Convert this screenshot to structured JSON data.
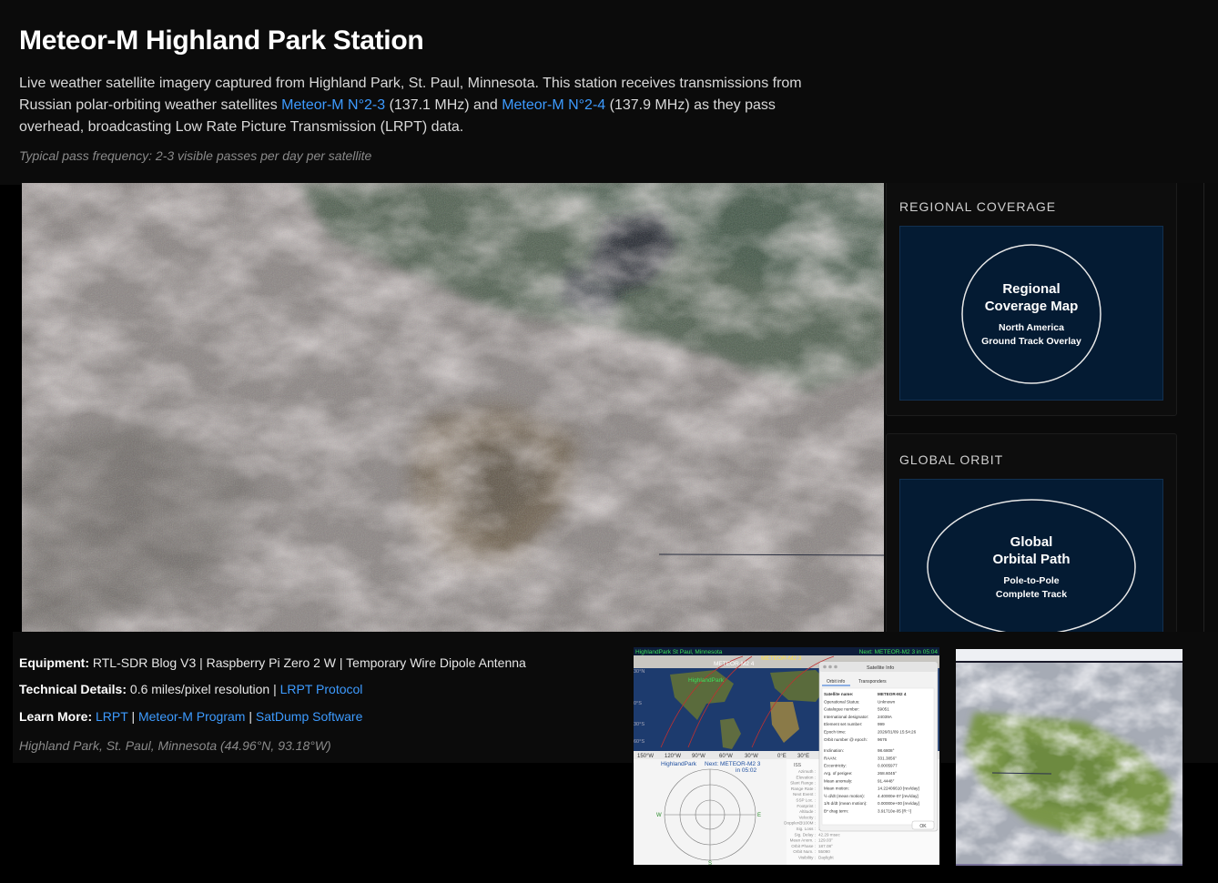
{
  "header": {
    "title": "Meteor-M Highland Park Station",
    "intro_part1": "Live weather satellite imagery captured from Highland Park, St. Paul, Minnesota. This station receives transmissions from Russian polar-orbiting weather satellites ",
    "link_m23": "Meteor-M N°2-3",
    "intro_part2": " (137.1 MHz) and ",
    "link_m24": "Meteor-M N°2-4",
    "intro_part3": " (137.9 MHz) as they pass overhead, broadcasting Low Rate Picture Transmission (LRPT) data.",
    "frequency_note": "Typical pass frequency: 2-3 visible passes per day per satellite"
  },
  "sidebar": {
    "regional": {
      "heading": "REGIONAL COVERAGE",
      "line1": "Regional",
      "line2": "Coverage Map",
      "line3": "North America",
      "line4": "Ground Track Overlay"
    },
    "global": {
      "heading": "GLOBAL ORBIT",
      "line1": "Global",
      "line2": "Orbital Path",
      "line3": "Pole-to-Pole",
      "line4": "Complete Track"
    }
  },
  "footer": {
    "equipment_label": "Equipment:",
    "equipment_value": " RTL-SDR Blog V3 | Raspberry Pi Zero 2 W | Temporary Wire Dipole Antenna",
    "tech_label": "Technical Details:",
    "tech_value": " 0.6 miles/pixel resolution | ",
    "tech_link": "LRPT Protocol",
    "learn_label": "Learn More:",
    "learn_link1": "LRPT",
    "sep": " | ",
    "learn_link2": "Meteor-M Program",
    "learn_link3": "SatDump Software",
    "location": "Highland Park, St. Paul, Minnesota (44.96°N, 93.18°W)"
  },
  "gpredict": {
    "map_location": "HighlandPark  St Paul, Minnesota",
    "map_next": "Next: METEOR-M2 3 in 05:04",
    "sat_label_1": "METEOR-M2 3",
    "sat_label_2": "METEOR-M2 4",
    "station_label": "HighlandPark",
    "lon_labels": [
      "150°W",
      "120°W",
      "90°W",
      "60°W",
      "30°W",
      "0°E",
      "30°E"
    ],
    "lat_labels": [
      "30°N",
      "0°S",
      "30°S",
      "60°S"
    ],
    "polar_title": "HighlandPark",
    "polar_next": "Next: METEOR-M2 3",
    "polar_in": "in 05:02",
    "polar_w": "W",
    "polar_e": "E",
    "polar_s": "S",
    "dialog_title": "Satellite Info",
    "dialog_tab1": "Orbit info",
    "dialog_tab2": "Transponders",
    "dialog_rows": [
      [
        "Satellite name:",
        "METEOR-M2 4"
      ],
      [
        "Operational Status:",
        "Unknown"
      ],
      [
        "Catalogue number:",
        "59051"
      ],
      [
        "International designator:",
        "24039A"
      ],
      [
        "Element set number:",
        "999"
      ],
      [
        "Epoch time:",
        "2026/01/09 15:54:26"
      ],
      [
        "Orbit number @ epoch:",
        "9676"
      ],
      [
        "Inclination:",
        "98.6808°"
      ],
      [
        "RAAN:",
        "331.3856°"
      ],
      [
        "Eccentricity:",
        "0.0005977"
      ],
      [
        "Arg. of perigee:",
        "268.6045°"
      ],
      [
        "Mean anomaly:",
        "91.4448°"
      ],
      [
        "Mean motion:",
        "14.22406610 [rev/day]"
      ],
      [
        "½ d/dt (mean motion):",
        "4.40000e-07 [rev/day]"
      ],
      [
        "1/6 d/dt (mean motion):",
        "0.00000e+00 [rev/day]"
      ],
      [
        "B* drag term:",
        "3.91710e-05 [R⁻¹]"
      ]
    ],
    "dialog_ok": "OK",
    "list_header": "ISS",
    "list_rows": [
      [
        "Azimuth :",
        ""
      ],
      [
        "Elevation :",
        ""
      ],
      [
        "Slant Range :",
        ""
      ],
      [
        "Range Rate :",
        ""
      ],
      [
        "Next Event :",
        ""
      ],
      [
        "SSP Loc. :",
        ""
      ],
      [
        "Footprint :",
        ""
      ],
      [
        "Altitude :",
        ""
      ],
      [
        "Velocity :",
        ""
      ],
      [
        "Doppler@100M :",
        ""
      ],
      [
        "Sig. Loss :",
        "155.94 dB"
      ],
      [
        "Sig. Delay :",
        "42.29 msec"
      ],
      [
        "Mean Anom. :",
        "129.03°"
      ],
      [
        "Orbit Phase :",
        "187.08°"
      ],
      [
        "Orbit Num. :",
        "55090"
      ],
      [
        "Visibility :",
        "Daylight"
      ]
    ]
  },
  "colors": {
    "link": "#3d9bff",
    "panel_box": "#041b33",
    "background": "#000000"
  }
}
